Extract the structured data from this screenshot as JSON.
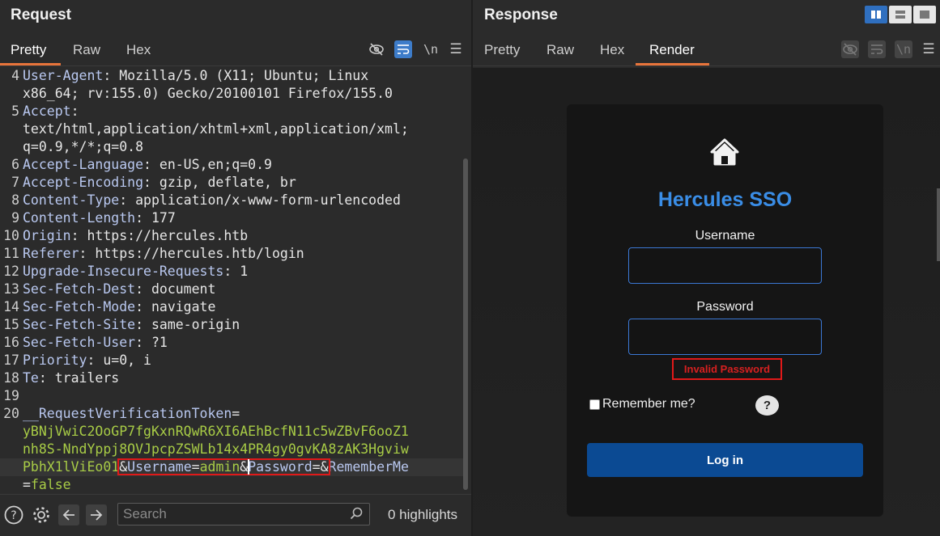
{
  "request": {
    "title": "Request",
    "tabs": [
      "Pretty",
      "Raw",
      "Hex"
    ],
    "active_tab": "Pretty",
    "newline_label": "\\n",
    "lines": [
      {
        "n": "4",
        "parts": [
          {
            "t": "User-Agent",
            "c": "hdr"
          },
          {
            "t": ": Mozilla/5.0 (X11; Ubuntu; Linux",
            "c": "val"
          }
        ]
      },
      {
        "n": "",
        "parts": [
          {
            "t": "x86_64; rv:155.0) Gecko/20100101 Firefox/155.0",
            "c": "val"
          }
        ]
      },
      {
        "n": "5",
        "parts": [
          {
            "t": "Accept",
            "c": "hdr"
          },
          {
            "t": ":",
            "c": "val"
          }
        ]
      },
      {
        "n": "",
        "parts": [
          {
            "t": "text/html,application/xhtml+xml,application/xml;",
            "c": "val"
          }
        ]
      },
      {
        "n": "",
        "parts": [
          {
            "t": "q=0.9,*/*;q=0.8",
            "c": "val"
          }
        ]
      },
      {
        "n": "6",
        "parts": [
          {
            "t": "Accept-Language",
            "c": "hdr"
          },
          {
            "t": ": en-US,en;q=0.9",
            "c": "val"
          }
        ]
      },
      {
        "n": "7",
        "parts": [
          {
            "t": "Accept-Encoding",
            "c": "hdr"
          },
          {
            "t": ": gzip, deflate, br",
            "c": "val"
          }
        ]
      },
      {
        "n": "8",
        "parts": [
          {
            "t": "Content-Type",
            "c": "hdr"
          },
          {
            "t": ": application/x-www-form-urlencoded",
            "c": "val"
          }
        ]
      },
      {
        "n": "9",
        "parts": [
          {
            "t": "Content-Length",
            "c": "hdr"
          },
          {
            "t": ": 177",
            "c": "val"
          }
        ]
      },
      {
        "n": "10",
        "parts": [
          {
            "t": "Origin",
            "c": "hdr"
          },
          {
            "t": ": https://hercules.htb",
            "c": "val"
          }
        ]
      },
      {
        "n": "11",
        "parts": [
          {
            "t": "Referer",
            "c": "hdr"
          },
          {
            "t": ": https://hercules.htb/login",
            "c": "val"
          }
        ]
      },
      {
        "n": "12",
        "parts": [
          {
            "t": "Upgrade-Insecure-Requests",
            "c": "hdr"
          },
          {
            "t": ": 1",
            "c": "val"
          }
        ]
      },
      {
        "n": "13",
        "parts": [
          {
            "t": "Sec-Fetch-Dest",
            "c": "hdr"
          },
          {
            "t": ": document",
            "c": "val"
          }
        ]
      },
      {
        "n": "14",
        "parts": [
          {
            "t": "Sec-Fetch-Mode",
            "c": "hdr"
          },
          {
            "t": ": navigate",
            "c": "val"
          }
        ]
      },
      {
        "n": "15",
        "parts": [
          {
            "t": "Sec-Fetch-Site",
            "c": "hdr"
          },
          {
            "t": ": same-origin",
            "c": "val"
          }
        ]
      },
      {
        "n": "16",
        "parts": [
          {
            "t": "Sec-Fetch-User",
            "c": "hdr"
          },
          {
            "t": ": ?1",
            "c": "val"
          }
        ]
      },
      {
        "n": "17",
        "parts": [
          {
            "t": "Priority",
            "c": "hdr"
          },
          {
            "t": ": u=0, i",
            "c": "val"
          }
        ]
      },
      {
        "n": "18",
        "parts": [
          {
            "t": "Te",
            "c": "hdr"
          },
          {
            "t": ": trailers",
            "c": "val"
          }
        ]
      },
      {
        "n": "19",
        "parts": []
      },
      {
        "n": "20",
        "parts": [
          {
            "t": "__RequestVerificationToken",
            "c": "key"
          },
          {
            "t": "=",
            "c": "val"
          }
        ]
      },
      {
        "n": "",
        "parts": [
          {
            "t": "yBNjVwiC2OoGP7fgKxnRQwR6XI6AEhBcfN11c5wZBvF6ooZ1",
            "c": "tok"
          }
        ]
      },
      {
        "n": "",
        "parts": [
          {
            "t": "nh8S-NndYppj8OVJpcpZSWLb14x4PR4gy0gvKA8zAK3Hgviw",
            "c": "tok"
          }
        ]
      },
      {
        "n": "",
        "parts": [
          {
            "t": "PbhX1lViEo01",
            "c": "tok"
          },
          {
            "t": "&",
            "c": "val"
          },
          {
            "t": "Username",
            "c": "key"
          },
          {
            "t": "=",
            "c": "val"
          },
          {
            "t": "admin",
            "c": "tok"
          },
          {
            "t": "&",
            "c": "val"
          },
          {
            "t": "Password",
            "c": "key"
          },
          {
            "t": "=",
            "c": "val"
          },
          {
            "t": "&",
            "c": "val"
          },
          {
            "t": "RememberMe",
            "c": "key"
          }
        ]
      },
      {
        "n": "",
        "parts": [
          {
            "t": "=",
            "c": "val"
          },
          {
            "t": "false",
            "c": "tok"
          }
        ]
      }
    ],
    "search_placeholder": "Search",
    "highlights": "0 highlights"
  },
  "response": {
    "title": "Response",
    "tabs": [
      "Pretty",
      "Raw",
      "Hex",
      "Render"
    ],
    "active_tab": "Render",
    "newline_label": "\\n",
    "page": {
      "title": "Hercules SSO",
      "username_label": "Username",
      "password_label": "Password",
      "error": "Invalid Password",
      "remember_label": "Remember me?",
      "help": "?",
      "login_button": "Log in"
    }
  },
  "colors": {
    "accent_tab": "#e8743b",
    "brand_blue": "#3a8de6",
    "login_button": "#0b4a93",
    "error_red": "#d62020"
  }
}
